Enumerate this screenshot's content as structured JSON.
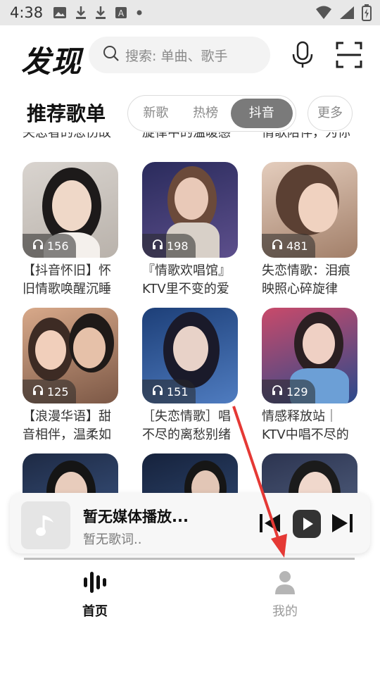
{
  "status_bar": {
    "time": "4:38",
    "icons": [
      "image-icon",
      "download-icon",
      "download-icon",
      "a-box-icon",
      "dot-icon"
    ],
    "right_icons": [
      "wifi-icon",
      "signal-icon",
      "battery-icon"
    ]
  },
  "header": {
    "title": "发现",
    "search_placeholder": "搜索: 单曲、歌手"
  },
  "section": {
    "title": "推荐歌单",
    "tabs": [
      {
        "label": "新歌",
        "active": false
      },
      {
        "label": "热榜",
        "active": false
      },
      {
        "label": "抖音",
        "active": true
      }
    ],
    "more_label": "更多"
  },
  "clipped_titles": [
    "失恋者的悲伤故",
    "旋律中的温暖感",
    "情歌陪伴，为你"
  ],
  "playlists": [
    {
      "count": "156",
      "title": "【抖音怀旧】怀旧情歌唤醒沉睡"
    },
    {
      "count": "198",
      "title": "『情歌欢唱馆』KTV里不变的爱"
    },
    {
      "count": "481",
      "title": "失恋情歌：泪痕映照心碎旋律"
    },
    {
      "count": "125",
      "title": "【浪漫华语】甜音相伴，温柔如"
    },
    {
      "count": "151",
      "title": "［失恋情歌］唱不尽的离愁别绪"
    },
    {
      "count": "129",
      "title": "情感释放站｜KTV中唱不尽的"
    }
  ],
  "player": {
    "title": "暂无媒体播放...",
    "lyric": "暂无歌词.."
  },
  "nav": {
    "home_label": "首页",
    "mine_label": "我的"
  },
  "colors": {
    "accent_gray": "#7a7a7a",
    "arrow_red": "#e53935"
  }
}
